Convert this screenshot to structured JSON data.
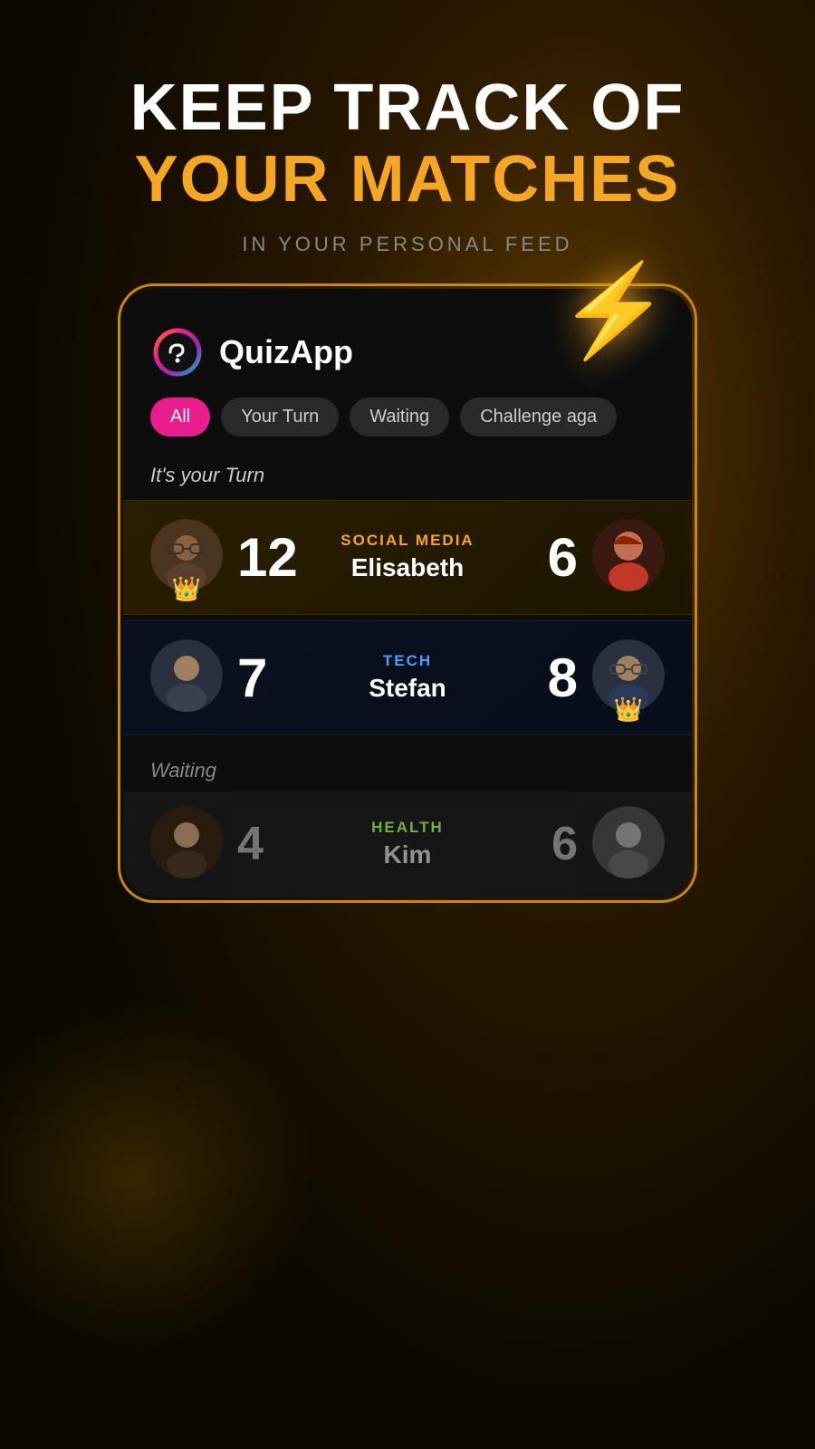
{
  "background": {
    "primary": "#0a0800",
    "glow": "#5a3a00"
  },
  "header": {
    "line1": "KEEP TRACK OF",
    "line2": "YOUR MATCHES",
    "subtitle": "IN YOUR PERSONAL FEED"
  },
  "lightning": "⚡",
  "app": {
    "name": "QuizApp"
  },
  "tabs": [
    {
      "label": "All",
      "active": true
    },
    {
      "label": "Your Turn",
      "active": false
    },
    {
      "label": "Waiting",
      "active": false
    },
    {
      "label": "Challenge aga",
      "active": false
    }
  ],
  "section_your_turn": "It's your Turn",
  "matches_your_turn": [
    {
      "score_left": "12",
      "category": "SOCIAL MEDIA",
      "category_color": "gold",
      "opponent": "Elisabeth",
      "score_right": "6",
      "left_crown": true,
      "right_crown": false
    },
    {
      "score_left": "7",
      "category": "TECH",
      "category_color": "blue",
      "opponent": "Stefan",
      "score_right": "8",
      "left_crown": false,
      "right_crown": true
    }
  ],
  "section_waiting": "Waiting",
  "matches_waiting": [
    {
      "score_left": "4",
      "category": "HEALTH",
      "category_color": "green",
      "opponent": "Kim",
      "score_right": "6",
      "left_crown": false,
      "right_crown": false
    }
  ]
}
